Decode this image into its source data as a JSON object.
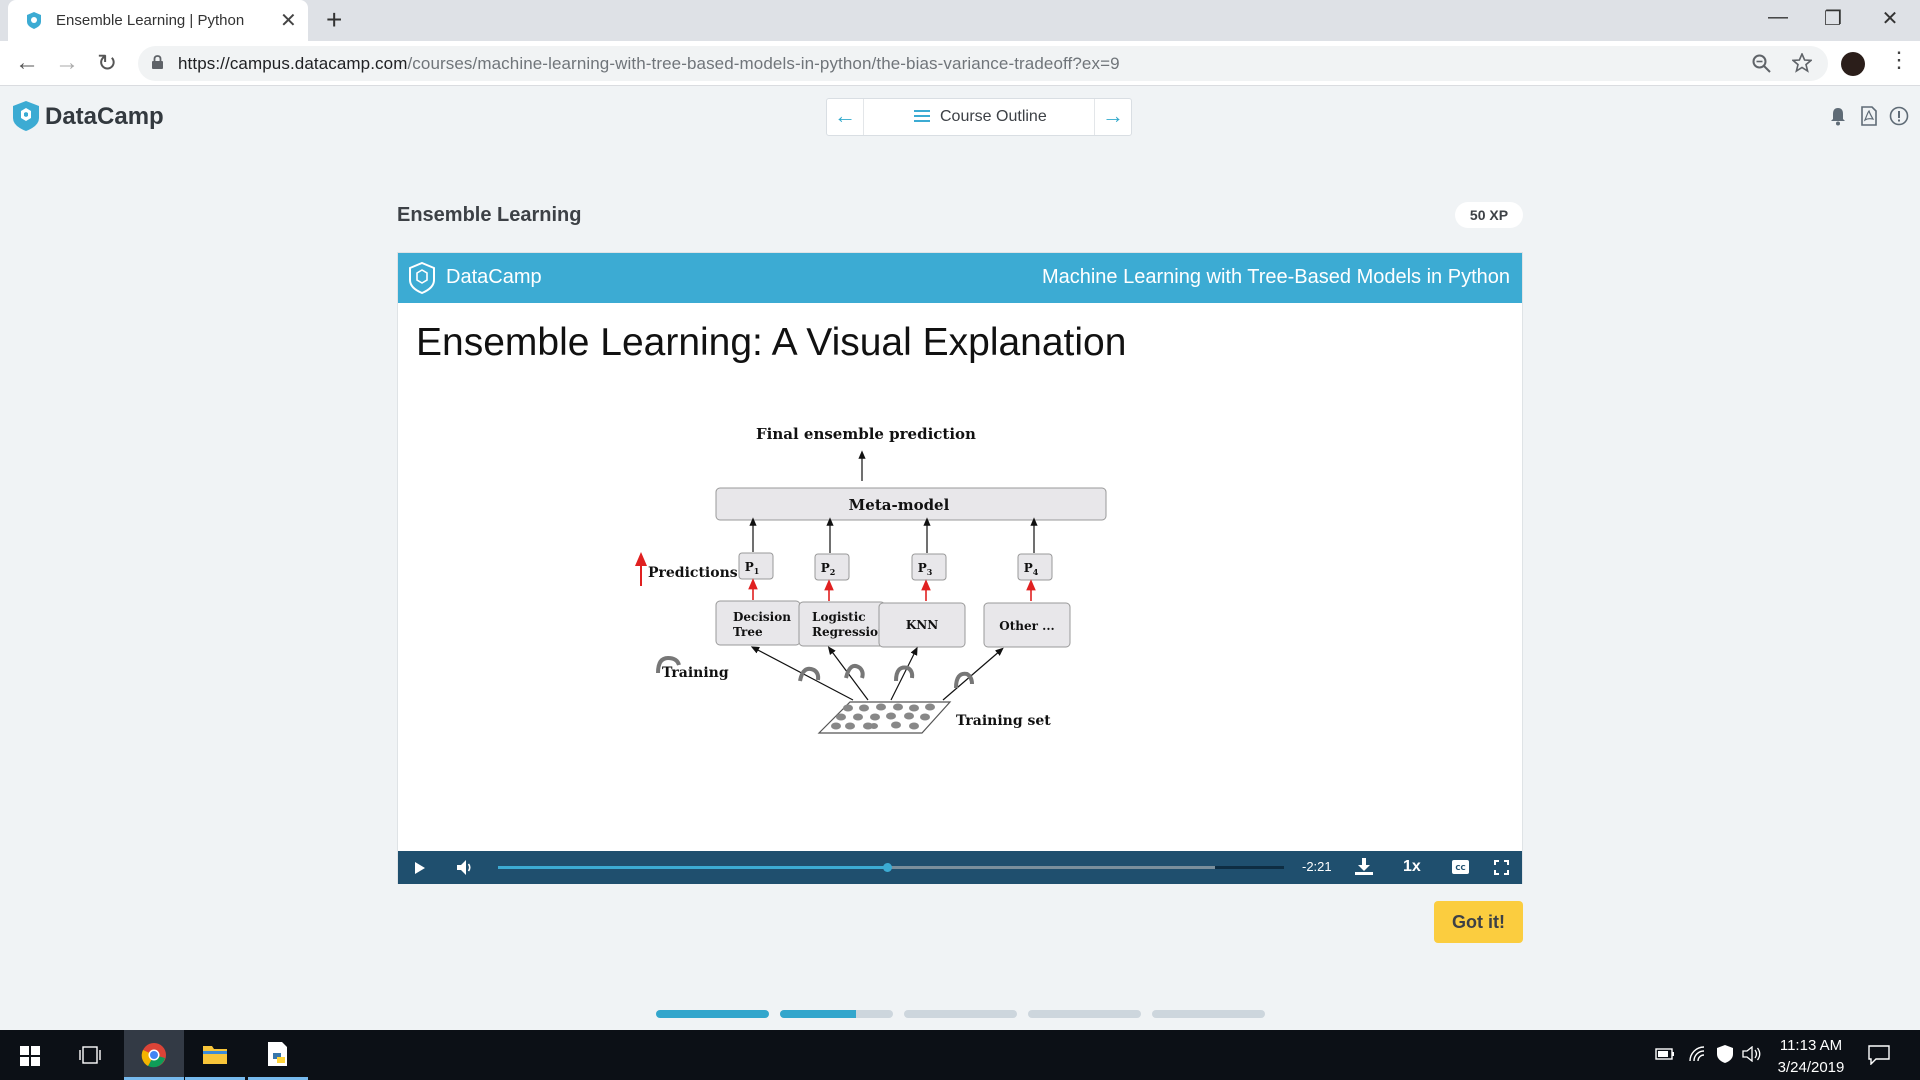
{
  "browser": {
    "tab_title": "Ensemble Learning | Python",
    "tab_close": "✕",
    "new_tab": "+",
    "url_host": "https://campus.datacamp.com",
    "url_path": "/courses/machine-learning-with-tree-based-models-in-python/the-bias-variance-tradeoff?ex=9",
    "nav": {
      "back": "←",
      "forward": "→",
      "reload": "↻"
    },
    "window": {
      "minimize": "—",
      "restore": "❐",
      "close": "✕"
    }
  },
  "header": {
    "brand": "DataCamp",
    "course_outline": "Course Outline",
    "prev": "←",
    "next": "→"
  },
  "exercise": {
    "title": "Ensemble Learning",
    "xp": "50 XP"
  },
  "video": {
    "brand": "DataCamp",
    "course": "Machine Learning with Tree-Based Models in Python",
    "slide_title": "Ensemble Learning: A Visual Explanation",
    "diagram": {
      "final": "Final ensemble prediction",
      "meta": "Meta-model",
      "predictions": "Predictions",
      "training": "Training",
      "training_set": "Training set",
      "p_labels": [
        "P",
        "P",
        "P",
        "P"
      ],
      "p_subs": [
        "1",
        "2",
        "3",
        "4"
      ],
      "models": [
        [
          "Decision",
          "Tree"
        ],
        [
          "Logistic",
          "Regression"
        ],
        [
          "KNN"
        ],
        [
          "Other ..."
        ]
      ]
    },
    "controls": {
      "time_remaining": "-2:21",
      "speed": "1x",
      "played_fraction": 0.495,
      "buffered_fraction": 0.912
    }
  },
  "got_it": "Got it!",
  "progress_segments": [
    1.0,
    0.67,
    0,
    0,
    0
  ],
  "taskbar": {
    "time": "11:13 AM",
    "date": "3/24/2019"
  },
  "colors": {
    "accent": "#3cabd3",
    "video_controls": "#1f4f6e",
    "got_it": "#fbcd3f"
  }
}
